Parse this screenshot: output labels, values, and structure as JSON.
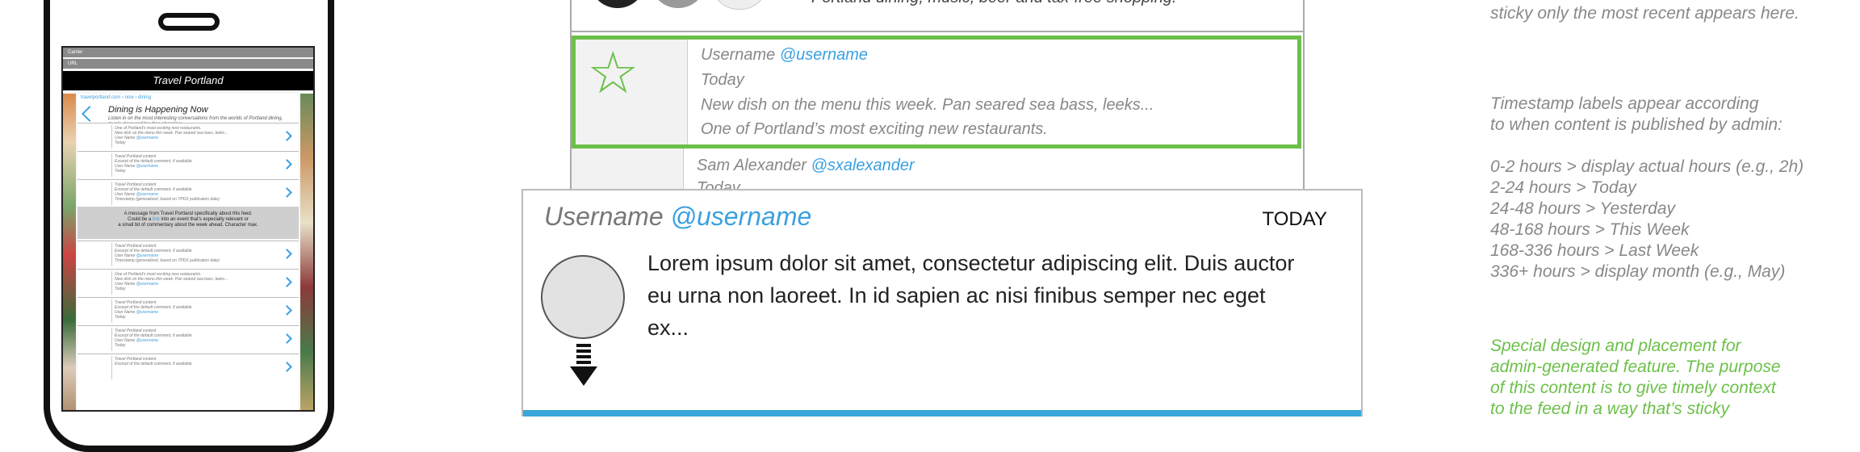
{
  "phone": {
    "status_carrier": "Carrier",
    "status_url": "URL",
    "title": "Travel Portland",
    "breadcrumb": "travelportland.com › now › dining",
    "hero_title": "Dining is Happening Now",
    "hero_sub": "Listen in on the most interesting conversations from the worlds of Portland dining, music, beer and tax-free shopping.",
    "rows_top": [
      {
        "l1": "One of Portland’s most exciting new restaurants.",
        "l2": "New dish on the menu this week. Pan seared sea bass, leeks...",
        "l3_pre": "User Name ",
        "l3_handle": "@username",
        "l4": "Today"
      },
      {
        "l1": "Travel Portland content",
        "l2": "Excerpt of the default comment, if available",
        "l3_pre": "User Name ",
        "l3_handle": "@username",
        "l4": "Today"
      },
      {
        "l1": "Travel Portland content",
        "l2": "Excerpt of the default comment, if available",
        "l3_pre": "User Name ",
        "l3_handle": "@username",
        "l4": "Timestamp (generalized, based on TPDX publication date)"
      }
    ],
    "message": {
      "line1": "A message from Travel Portland specifically about this feed.",
      "line2_pre": "Could be a ",
      "line2_link": "link",
      "line2_post": " into an event that’s especially relevant or",
      "line3": "a small bit of commentary about the week ahead. Character max."
    },
    "rows_bottom": [
      {
        "l1": "Travel Portland content",
        "l2": "Excerpt of the default comment, if available",
        "l3_pre": "User Name ",
        "l3_handle": "@username",
        "l4": "Timestamp (generalized, based on TPDX publication date)"
      },
      {
        "l1": "One of Portland’s most exciting new restaurants.",
        "l2": "New dish on the menu this week. Pan seared sea bass, leeks...",
        "l3_pre": "User Name ",
        "l3_handle": "@username",
        "l4": "Today"
      },
      {
        "l1": "Travel Portland content",
        "l2": "Excerpt of the default comment, if available",
        "l3_pre": "User Name ",
        "l3_handle": "@username",
        "l4": "Today"
      },
      {
        "l1": "Travel Portland content",
        "l2": "Excerpt of the default comment, if available",
        "l3_pre": "User Name ",
        "l3_handle": "@username",
        "l4": "Today"
      },
      {
        "l1": "Travel Portland content",
        "l2": "Excerpt of the default comment, if available",
        "l3_pre": "",
        "l3_handle": "",
        "l4": ""
      }
    ]
  },
  "feed": {
    "top_text": "Portland dining, music, beer and tax-free shopping.",
    "featured": {
      "user_name": "Username ",
      "user_handle": "@username",
      "date": "Today",
      "body1": "New dish on the menu this week. Pan seared sea bass, leeks...",
      "body2": "One of Portland’s most exciting new restaurants."
    },
    "row2": {
      "user_name": "Sam Alexander ",
      "user_handle": "@sxalexander",
      "date": "Today"
    }
  },
  "card": {
    "user_name": "Username ",
    "user_handle": "@username",
    "time": "TODAY",
    "body": "Lorem ipsum dolor sit amet, consectetur adipiscing elit. Duis auctor eu urna non laoreet. In id sapien ac nisi finibus semper nec eget ex..."
  },
  "notes": {
    "top": [
      "sticky only the most recent appears here."
    ],
    "timestamp_intro": [
      "Timestamp labels appear according",
      "to when content is published by admin:"
    ],
    "timestamp_rules": [
      "0-2 hours > display actual hours (e.g., 2h)",
      "2-24 hours > Today",
      "24-48 hours > Yesterday",
      "48-168 hours > This Week",
      "168-336 hours > Last Week",
      "336+ hours > display month (e.g., May)"
    ],
    "special": [
      "Special design and placement for",
      "admin-generated feature. The purpose",
      "of this content is to give timely context",
      "to the feed in a way that’s sticky"
    ]
  },
  "colors": {
    "accent_blue": "#3aa0e0",
    "accent_green": "#6cc04a",
    "card_bottom": "#3aa7d8"
  },
  "icons": {
    "featured": "star-icon",
    "back": "chevron-left-icon",
    "row": "chevron-right-icon",
    "card": "download-arrow-icon"
  }
}
